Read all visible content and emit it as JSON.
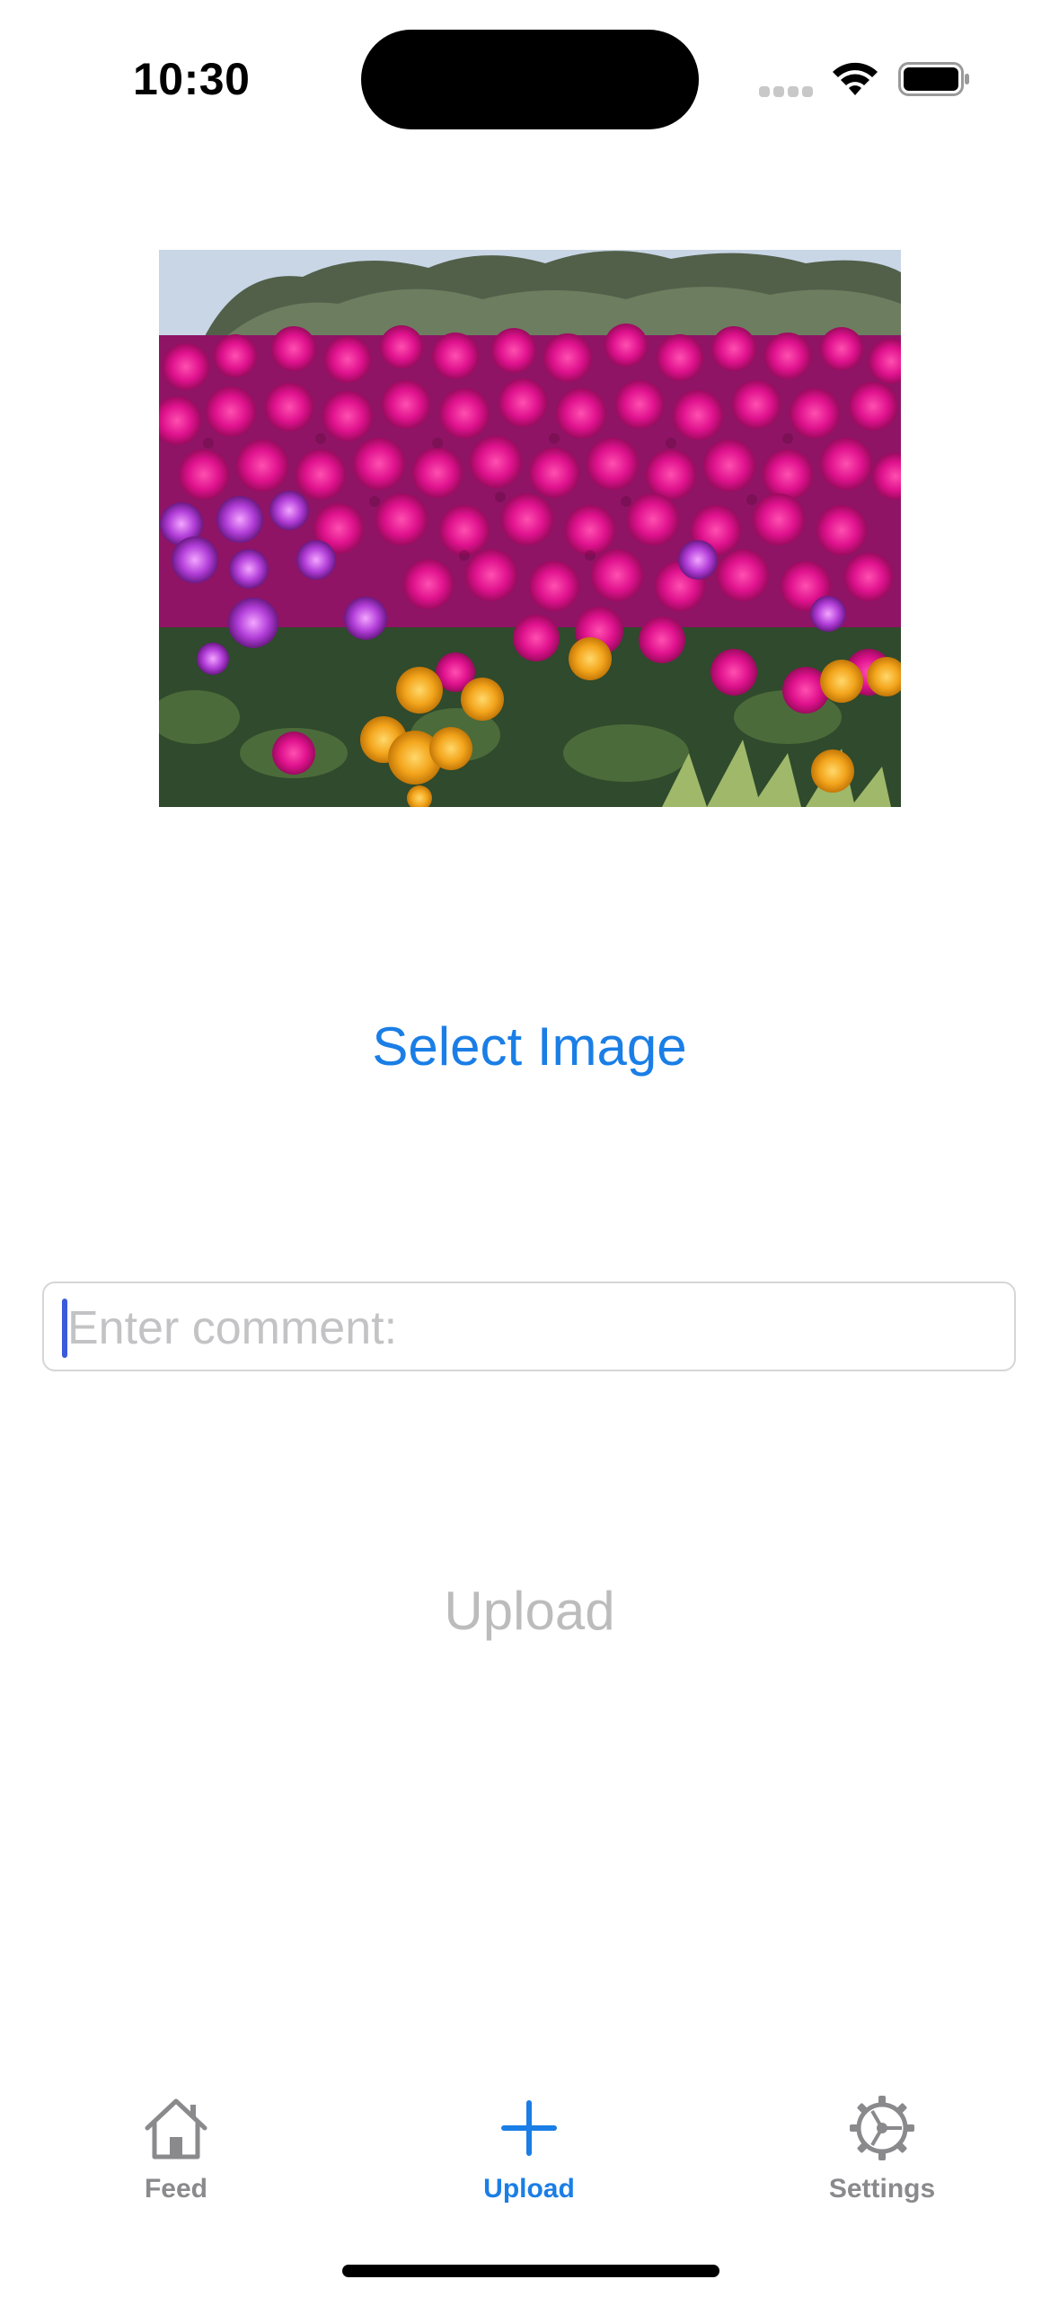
{
  "status_bar": {
    "time": "10:30",
    "icons": [
      "cellular-signal-icon",
      "wifi-icon",
      "battery-icon"
    ]
  },
  "photo": {
    "description_icon": "selected-photo"
  },
  "select_image_label": "Select Image",
  "comment": {
    "placeholder": "Enter comment:",
    "value": ""
  },
  "upload_label": "Upload",
  "tab_bar": {
    "items": [
      {
        "label": "Feed",
        "icon": "house-icon",
        "selected": false
      },
      {
        "label": "Upload",
        "icon": "plus-icon",
        "selected": true
      },
      {
        "label": "Settings",
        "icon": "gear-icon",
        "selected": false
      }
    ]
  },
  "colors": {
    "accent": "#1a7ee6",
    "inactive_tab": "#8a8a8d",
    "disabled_text": "#bcbcbc",
    "placeholder": "#c3c3c5"
  }
}
